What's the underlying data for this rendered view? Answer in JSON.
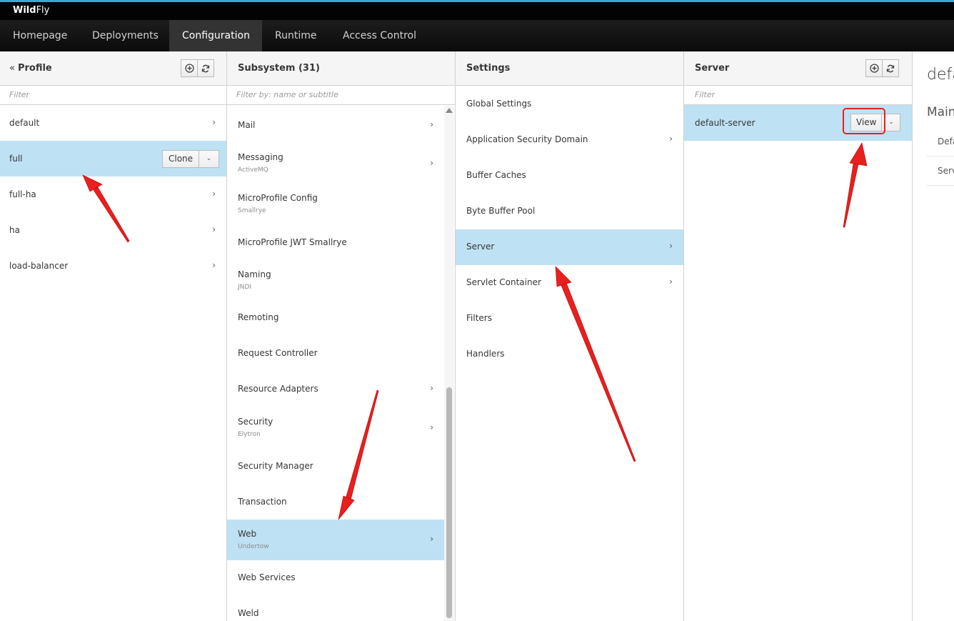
{
  "brand": {
    "bold": "Wild",
    "rest": "Fly"
  },
  "nav": {
    "items": [
      {
        "label": "Homepage"
      },
      {
        "label": "Deployments"
      },
      {
        "label": "Configuration"
      },
      {
        "label": "Runtime"
      },
      {
        "label": "Access Control"
      }
    ],
    "active": "Configuration"
  },
  "profile": {
    "back_glyph": "«",
    "title": "Profile",
    "filter_placeholder": "Filter",
    "items": [
      {
        "label": "default"
      },
      {
        "label": "full",
        "selected": true
      },
      {
        "label": "full-ha"
      },
      {
        "label": "ha"
      },
      {
        "label": "load-balancer"
      }
    ],
    "clone_label": "Clone"
  },
  "subsystem": {
    "title": "Subsystem (31)",
    "filter_placeholder": "Filter by: name or subtitle",
    "items": [
      {
        "label": "Mail",
        "sub": ""
      },
      {
        "label": "Messaging",
        "sub": "ActiveMQ"
      },
      {
        "label": "MicroProfile Config",
        "sub": "Smallrye"
      },
      {
        "label": "MicroProfile JWT Smallrye",
        "sub": ""
      },
      {
        "label": "Naming",
        "sub": "JNDI"
      },
      {
        "label": "Remoting",
        "sub": ""
      },
      {
        "label": "Request Controller",
        "sub": ""
      },
      {
        "label": "Resource Adapters",
        "sub": ""
      },
      {
        "label": "Security",
        "sub": "Elytron"
      },
      {
        "label": "Security Manager",
        "sub": ""
      },
      {
        "label": "Transaction",
        "sub": ""
      },
      {
        "label": "Web",
        "sub": "Undertow",
        "selected": true
      },
      {
        "label": "Web Services",
        "sub": ""
      },
      {
        "label": "Weld",
        "sub": ""
      }
    ]
  },
  "settings": {
    "title": "Settings",
    "items": [
      {
        "label": "Global Settings"
      },
      {
        "label": "Application Security Domain"
      },
      {
        "label": "Buffer Caches"
      },
      {
        "label": "Byte Buffer Pool"
      },
      {
        "label": "Server",
        "selected": true
      },
      {
        "label": "Servlet Container"
      },
      {
        "label": "Filters"
      },
      {
        "label": "Handlers"
      }
    ]
  },
  "server": {
    "title": "Server",
    "filter_placeholder": "Filter",
    "items": [
      {
        "label": "default-server",
        "selected": true
      }
    ],
    "view_label": "View"
  },
  "detail": {
    "title": "defa",
    "subtitle": "Main",
    "items": [
      {
        "label": "Defa"
      },
      {
        "label": "Serv"
      }
    ]
  },
  "colors": {
    "selected": "#bee1f4",
    "accent": "#39a5dc",
    "annotation": "#e8201e"
  }
}
